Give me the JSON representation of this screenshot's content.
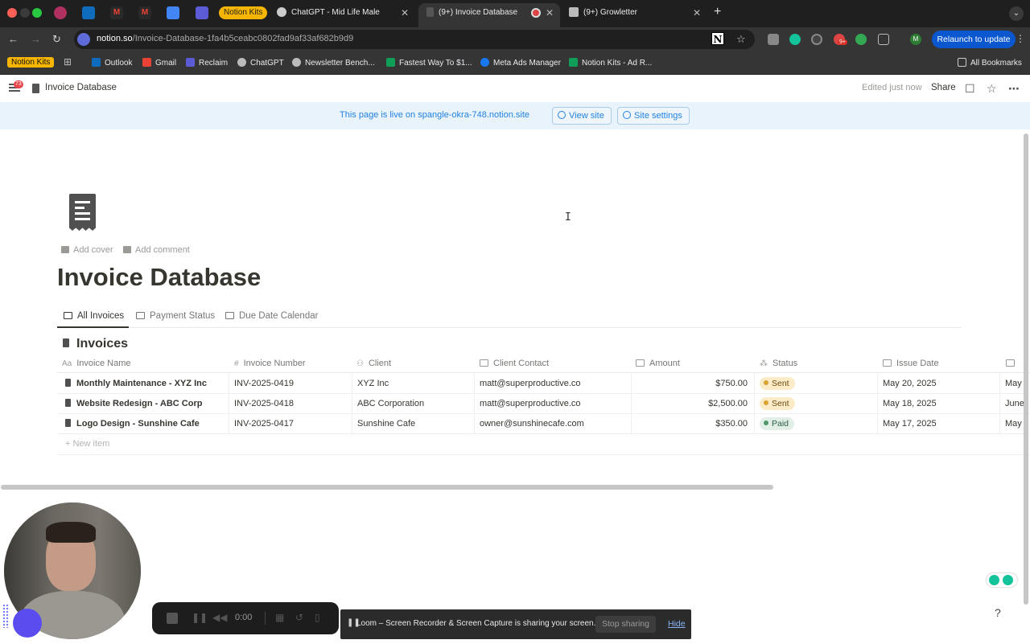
{
  "browser": {
    "tabs": [
      {
        "label": "Notion Kits",
        "pill": true
      },
      {
        "label": "ChatGPT - Mid Life Male"
      },
      {
        "label": "(9+) Invoice Database",
        "active": true
      },
      {
        "label": "(9+) Growletter"
      }
    ],
    "url_host": "notion.so",
    "url_path": "/Invoice-Database-1fa4b5ceabc0802fad9af33af682b9d9",
    "relaunch_label": "Relaunch to update",
    "profile_initial": "M",
    "ext_badge": "9+",
    "bookmarks": [
      "Notion Kits",
      "Outlook",
      "Gmail",
      "Reclaim",
      "ChatGPT",
      "Newsletter Bench...",
      "Fastest Way To $1...",
      "Meta Ads Manager",
      "Notion Kits - Ad R..."
    ],
    "all_bookmarks": "All Bookmarks"
  },
  "notion": {
    "menu_badge": "73",
    "breadcrumb": "Invoice Database",
    "edited": "Edited just now",
    "share": "Share",
    "banner_text": "This page is live on spangle-okra-748.notion.site",
    "view_site": "View site",
    "site_settings": "Site settings",
    "add_cover": "Add cover",
    "add_comment": "Add comment",
    "page_title": "Invoice Database",
    "views": [
      "All Invoices",
      "Payment Status",
      "Due Date Calendar"
    ],
    "db_title": "Invoices",
    "headers": [
      "Invoice Name",
      "Invoice Number",
      "Client",
      "Client Contact",
      "Amount",
      "Status",
      "Issue Date"
    ],
    "rows": [
      {
        "name": "Monthly Maintenance - XYZ Inc",
        "number": "INV-2025-0419",
        "client": "XYZ Inc",
        "contact": "matt@superproductive.co",
        "amount": "$750.00",
        "status": "Sent",
        "issue": "May 20, 2025",
        "due": "May"
      },
      {
        "name": "Website Redesign - ABC Corp",
        "number": "INV-2025-0418",
        "client": "ABC Corporation",
        "contact": "matt@superproductive.co",
        "amount": "$2,500.00",
        "status": "Sent",
        "issue": "May 18, 2025",
        "due": "June"
      },
      {
        "name": "Logo Design - Sunshine Cafe",
        "number": "INV-2025-0417",
        "client": "Sunshine Cafe",
        "contact": "owner@sunshinecafe.com",
        "amount": "$350.00",
        "status": "Paid",
        "issue": "May 17, 2025",
        "due": "May"
      }
    ],
    "new_item": "New item"
  },
  "recorder": {
    "time": "0:00",
    "loom_message": "Loom – Screen Recorder & Screen Capture is sharing your screen.",
    "stop_sharing": "Stop sharing",
    "hide": "Hide"
  },
  "colors": {
    "accent": "#2383e2",
    "sent_bg": "#fbecc7",
    "paid_bg": "#e1efe7",
    "relaunch": "#0b57d0"
  }
}
